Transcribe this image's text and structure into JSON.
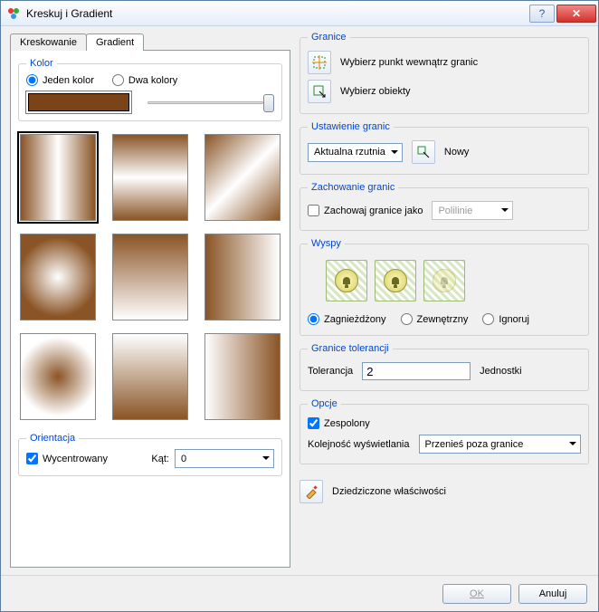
{
  "window": {
    "title": "Kreskuj i Gradient"
  },
  "tabs": {
    "hatching": "Kreskowanie",
    "gradient": "Gradient"
  },
  "color_group": {
    "legend": "Kolor",
    "one_color": "Jeden kolor",
    "two_colors": "Dwa kolory"
  },
  "orientation": {
    "legend": "Orientacja",
    "centered": "Wycentrowany",
    "angle_label": "Kąt:",
    "angle_value": "0"
  },
  "boundaries": {
    "legend": "Granice",
    "pick_point": "Wybierz punkt wewnątrz granic",
    "select_objects": "Wybierz obiekty"
  },
  "boundary_set": {
    "legend": "Ustawienie granic",
    "current_viewport": "Aktualna rzutnia",
    "new": "Nowy"
  },
  "boundary_retain": {
    "legend": "Zachowanie granic",
    "retain_as": "Zachowaj granice jako",
    "polyline": "Polilinie"
  },
  "islands": {
    "legend": "Wyspy",
    "nested": "Zagnieżdżony",
    "outer": "Zewnętrzny",
    "ignore": "Ignoruj"
  },
  "tolerance": {
    "legend": "Granice tolerancji",
    "label": "Tolerancja",
    "value": "2",
    "units": "Jednostki"
  },
  "options": {
    "legend": "Opcje",
    "composite": "Zespolony",
    "draw_order_label": "Kolejność wyświetlania",
    "draw_order_value": "Przenieś poza granice"
  },
  "inherit": "Dziedziczone właściwości",
  "buttons": {
    "ok": "OK",
    "cancel": "Anuluj"
  }
}
